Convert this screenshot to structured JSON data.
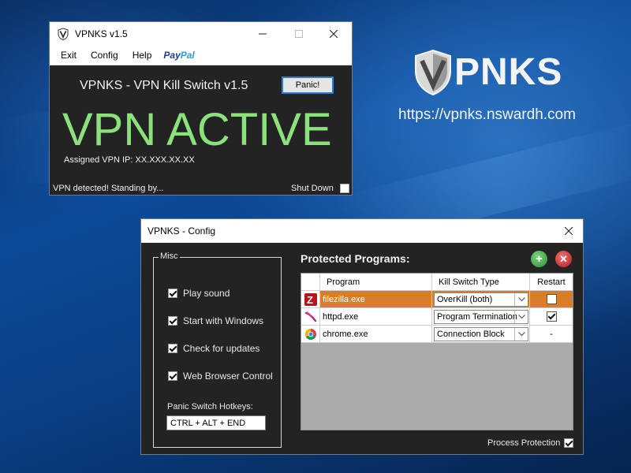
{
  "main_window": {
    "title": "VPNKS v1.5",
    "menu": [
      "Exit",
      "Config",
      "Help"
    ],
    "paypal_part1": "Pay",
    "paypal_part2": "Pal",
    "app_title": "VPNKS - VPN Kill Switch v1.5",
    "panic_label": "Panic!",
    "status_big": "VPN ACTIVE",
    "assigned_ip": "Assigned VPN IP: XX.XXX.XX.XX",
    "status_text": "VPN detected! Standing by...",
    "shutdown_label": "Shut Down",
    "shutdown_checked": false
  },
  "brand": {
    "name": "PNKS",
    "url": "https://vpnks.nswardh.com"
  },
  "config_window": {
    "title": "VPNKS - Config",
    "misc": {
      "legend": "Misc",
      "options": [
        {
          "label": "Play sound",
          "checked": true
        },
        {
          "label": "Start with Windows",
          "checked": true
        },
        {
          "label": "Check for updates",
          "checked": true
        },
        {
          "label": "Web Browser Control",
          "checked": true
        }
      ],
      "hotkey_label": "Panic Switch Hotkeys:",
      "hotkey_value": "CTRL + ALT + END"
    },
    "protected": {
      "title": "Protected Programs:",
      "columns": [
        "Program",
        "Kill Switch Type",
        "Restart"
      ],
      "rows": [
        {
          "icon": "filezilla-icon",
          "program": "filezilla.exe",
          "type": "OverKill (both)",
          "restart": "unchecked",
          "selected": true
        },
        {
          "icon": "httpd-icon",
          "program": "httpd.exe",
          "type": "Program Termination",
          "restart": "checked",
          "selected": false
        },
        {
          "icon": "chrome-icon",
          "program": "chrome.exe",
          "type": "Connection Block",
          "restart": "-",
          "selected": false
        }
      ]
    },
    "process_protection_label": "Process Protection",
    "process_protection_checked": true
  },
  "colors": {
    "vpn_active_green": "#8be27a",
    "selected_row": "#d87e2b",
    "window_dark": "#232323"
  }
}
